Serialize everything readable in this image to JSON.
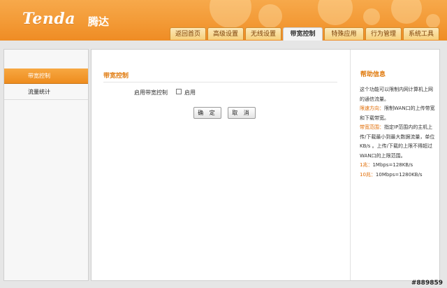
{
  "brand": {
    "logo_text": "Tenda",
    "logo_cn": "腾达"
  },
  "nav": {
    "tabs": [
      {
        "label": "返回首页",
        "active": false
      },
      {
        "label": "高级设置",
        "active": false
      },
      {
        "label": "无线设置",
        "active": false
      },
      {
        "label": "带宽控制",
        "active": true
      },
      {
        "label": "特殊应用",
        "active": false
      },
      {
        "label": "行为管理",
        "active": false
      },
      {
        "label": "系统工具",
        "active": false
      }
    ]
  },
  "sidebar": {
    "items": [
      {
        "label": "带宽控制",
        "active": true
      },
      {
        "label": "流量统计",
        "active": false
      }
    ]
  },
  "main": {
    "section_title": "带宽控制",
    "enable_label": "启用带宽控制",
    "enable_checkbox_label": "启用",
    "enable_checked": false,
    "ok_button": "确 定",
    "cancel_button": "取 消"
  },
  "help": {
    "title": "帮助信息",
    "intro": "这个功能可以限制内网计算机上网的通信流量。",
    "direction_term": "限速方向：",
    "direction_text": "限制WAN口的上传带宽和下载带宽。",
    "range_term": "带宽范围：",
    "range_text": "指定IP范围内的主机上传/下载最小到最大数据流量，单位KB/s 。上传/下载的上限不得超过WAN口的上限范围。",
    "example1_term": "1兆：",
    "example1_text": "1Mbps=128KB/s",
    "example2_term": "10兆：",
    "example2_text": "10Mbps=1280KB/s"
  },
  "watermark": "#889859",
  "colors": {
    "accent": "#ef8c24",
    "title": "#e07b0f",
    "highlight": "#e06a00"
  }
}
